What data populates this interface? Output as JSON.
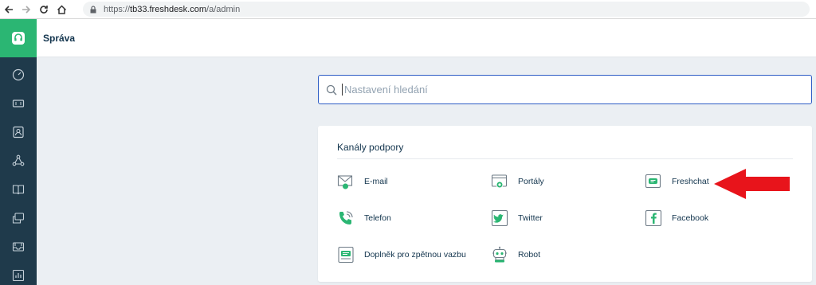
{
  "browser": {
    "url_scheme": "https://",
    "url_host": "tb33.freshdesk.com",
    "url_path": "/a/admin",
    "back_icon": "arrow-left-icon",
    "forward_icon": "arrow-right-icon",
    "reload_icon": "reload-icon",
    "home_icon": "home-icon",
    "lock_icon": "lock-icon"
  },
  "header": {
    "title": "Správa"
  },
  "sidebar": {
    "logo_icon": "headset-icon",
    "items": [
      {
        "icon": "dashboard-icon"
      },
      {
        "icon": "ticket-icon"
      },
      {
        "icon": "contacts-icon"
      },
      {
        "icon": "social-icon"
      },
      {
        "icon": "book-icon"
      },
      {
        "icon": "forums-icon"
      },
      {
        "icon": "inbox-icon"
      },
      {
        "icon": "reports-icon"
      }
    ]
  },
  "search": {
    "placeholder": "Nastavení hledání",
    "icon": "search-icon"
  },
  "support_channels": {
    "title": "Kanály podpory",
    "items": [
      {
        "label": "E-mail",
        "icon": "email-icon"
      },
      {
        "label": "Portály",
        "icon": "portal-icon"
      },
      {
        "label": "Freshchat",
        "icon": "chat-icon"
      },
      {
        "label": "Telefon",
        "icon": "phone-icon"
      },
      {
        "label": "Twitter",
        "icon": "twitter-icon"
      },
      {
        "label": "Facebook",
        "icon": "facebook-icon"
      },
      {
        "label": "Doplněk pro zpětnou vazbu",
        "icon": "feedback-widget-icon"
      },
      {
        "label": "Robot",
        "icon": "robot-icon"
      }
    ]
  },
  "annotation": {
    "arrow_color": "#e8141b",
    "icon": "red-arrow-icon"
  },
  "colors": {
    "brand_green": "#2bb673",
    "sidebar": "#1f3a4b",
    "icon_green": "#2bb673",
    "text": "#12344d"
  }
}
